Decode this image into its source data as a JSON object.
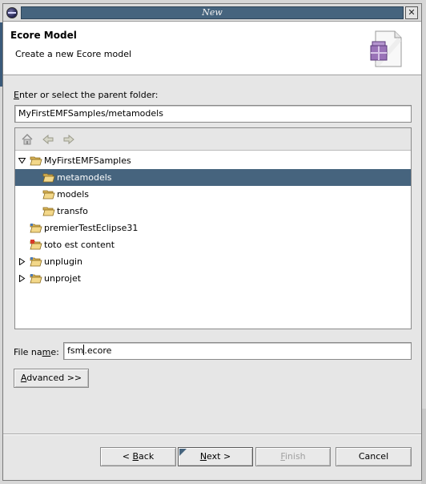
{
  "window": {
    "title": "New",
    "close_glyph": "✕"
  },
  "header": {
    "title": "Ecore Model",
    "description": "Create a new Ecore model",
    "icon": "new-ecore-model-wizard-icon"
  },
  "parent_folder": {
    "label_mnemonic": "E",
    "label_rest": "nter or select the parent folder:",
    "value": "MyFirstEMFSamples/metamodels"
  },
  "toolbar": {
    "buttons": [
      "home-icon",
      "back-arrow-icon",
      "forward-arrow-icon"
    ]
  },
  "tree": {
    "items": [
      {
        "label": "MyFirstEMFSamples",
        "expanded": true,
        "level": 0
      },
      {
        "label": "metamodels",
        "level": 1,
        "selected": true
      },
      {
        "label": "models",
        "level": 1
      },
      {
        "label": "transfo",
        "level": 1
      },
      {
        "label": "premierTestEclipse31",
        "level": 0
      },
      {
        "label": "toto est content",
        "level": 0
      },
      {
        "label": "unplugin",
        "expanded": false,
        "level": 0
      },
      {
        "label": "unprojet",
        "expanded": false,
        "level": 0
      }
    ]
  },
  "file_name": {
    "label_pre": "File na",
    "label_mnemonic": "m",
    "label_post": "e:",
    "value_before_caret": "fsm",
    "value_after_caret": ".ecore"
  },
  "advanced_button": {
    "mnemonic": "A",
    "rest": "dvanced >>"
  },
  "buttons": {
    "back": {
      "pre": "< ",
      "mnemonic": "B",
      "rest": "ack"
    },
    "next": {
      "mnemonic": "N",
      "rest": "ext >"
    },
    "finish": {
      "mnemonic": "F",
      "rest": "inish"
    },
    "cancel": "Cancel"
  },
  "colors": {
    "selection": "#46647e",
    "title_strip": "#46647e"
  }
}
